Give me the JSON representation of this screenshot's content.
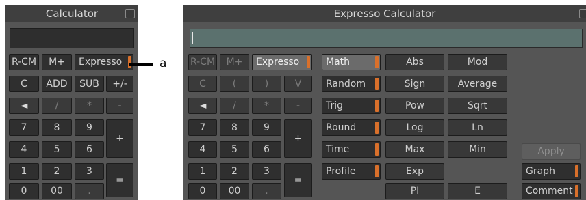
{
  "small_calc": {
    "title": "Calculator",
    "buttons": {
      "rcm": "R-CM",
      "mplus": "M+",
      "expresso": "Expresso",
      "c": "C",
      "add": "ADD",
      "sub": "SUB",
      "plusminus": "+/-",
      "back": "◄",
      "div": "/",
      "mul": "*",
      "minus": "-",
      "d7": "7",
      "d8": "8",
      "d9": "9",
      "plus": "+",
      "d4": "4",
      "d5": "5",
      "d6": "6",
      "d1": "1",
      "d2": "2",
      "d3": "3",
      "equals": "=",
      "d0": "0",
      "d00": "00",
      "dot": "."
    }
  },
  "callout": {
    "label": "a"
  },
  "expresso_calc": {
    "title": "Expresso Calculator",
    "buttons": {
      "rcm": "R-CM",
      "mplus": "M+",
      "expresso": "Expresso",
      "c": "C",
      "lparen": "(",
      "rparen": ")",
      "v": "V",
      "back": "◄",
      "div": "/",
      "mul": "*",
      "minus": "-",
      "d7": "7",
      "d8": "8",
      "d9": "9",
      "plus": "+",
      "d4": "4",
      "d5": "5",
      "d6": "6",
      "d1": "1",
      "d2": "2",
      "d3": "3",
      "equals": "=",
      "d0": "0",
      "d00": "00",
      "dot": "."
    },
    "categories": [
      "Math",
      "Random",
      "Trig",
      "Round",
      "Time",
      "Profile"
    ],
    "functions": {
      "abs": "Abs",
      "mod": "Mod",
      "sign": "Sign",
      "average": "Average",
      "pow": "Pow",
      "sqrt": "Sqrt",
      "log": "Log",
      "ln": "Ln",
      "max": "Max",
      "min": "Min",
      "exp": "Exp",
      "pi": "PI",
      "e": "E"
    },
    "actions": {
      "apply": "Apply",
      "graph": "Graph",
      "comment": "Comment"
    }
  }
}
